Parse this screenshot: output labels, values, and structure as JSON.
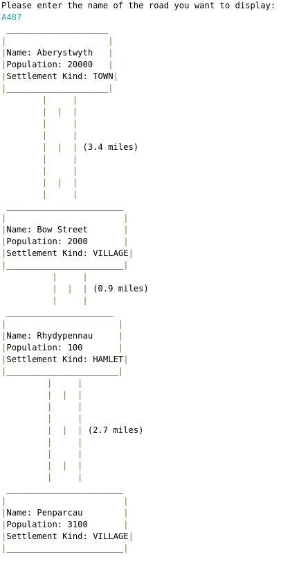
{
  "prompt": "Please enter the name of the road you want to display:",
  "road_input": "A487",
  "settlements": [
    {
      "box_top": " ____________________",
      "blank_top": "|                    |",
      "name_line": "|Name: Aberystwyth   |",
      "population_line": "|Population: 20000   |",
      "kind_line": "|Settlement Kind: TOWN|",
      "box_bottom": "|____________________|",
      "name": "Aberystwyth",
      "population": "20000",
      "kind": "TOWN"
    },
    {
      "box_top": " _______________________",
      "blank_top": "|                       |",
      "name_line": "|Name: Bow Street       |",
      "population_line": "|Population: 2000       |",
      "kind_line": "|Settlement Kind: VILLAGE|",
      "box_bottom": "|_______________________|",
      "name": "Bow Street",
      "population": "2000",
      "kind": "VILLAGE"
    },
    {
      "box_top": " _____________________",
      "blank_top": "|                      |",
      "name_line": "|Name: Rhydypennau     |",
      "population_line": "|Population: 100       |",
      "kind_line": "|Settlement Kind: HAMLET|",
      "box_bottom": "|______________________|",
      "name": "Rhydypennau",
      "population": "100",
      "kind": "HAMLET"
    },
    {
      "box_top": " _______________________",
      "blank_top": "|                       |",
      "name_line": "|Name: Penparcau        |",
      "population_line": "|Population: 3100       |",
      "kind_line": "|Settlement Kind: VILLAGE|",
      "box_bottom": "|_______________________|",
      "name": "Penparcau",
      "population": "3100",
      "kind": "VILLAGE"
    }
  ],
  "roads": [
    {
      "distance": "(3.4 miles)",
      "lines": [
        "        |     |",
        "        |  |  |",
        "        |     |",
        "        |     |",
        "        |  |  | ",
        "        |     |",
        "        |     |",
        "        |  |  |",
        "        |     |"
      ],
      "label_row": 4
    },
    {
      "distance": "(0.9 miles)",
      "lines": [
        "          |     |",
        "          |  |  | ",
        "          |     |"
      ],
      "label_row": 1
    },
    {
      "distance": "(2.7 miles)",
      "lines": [
        "         |     |",
        "         |  |  |",
        "         |     |",
        "         |     |",
        "         |  |  | ",
        "         |     |",
        "         |     |",
        "         |  |  |",
        "         |     |"
      ],
      "label_row": 4
    }
  ]
}
